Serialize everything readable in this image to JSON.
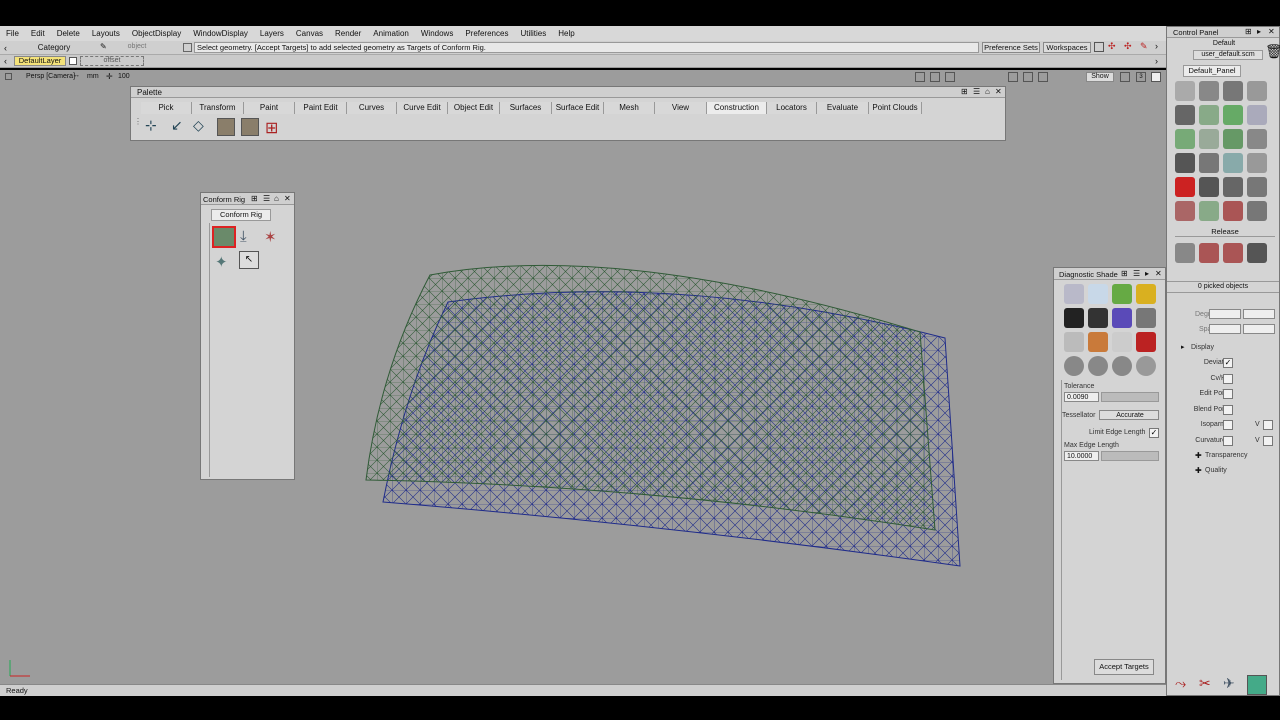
{
  "menu": [
    "File",
    "Edit",
    "Delete",
    "Layouts",
    "ObjectDisplay",
    "WindowDisplay",
    "Layers",
    "Canvas",
    "Render",
    "Animation",
    "Windows",
    "Preferences",
    "Utilities",
    "Help"
  ],
  "toolbar": {
    "category_label": "Category",
    "object_label": "object",
    "prompt": "Select geometry. [Accept Targets] to add selected geometry as Targets of Conform Rig.",
    "preference_sets": "Preference Sets",
    "workspaces": "Workspaces",
    "layer": "DefaultLayer",
    "offset": "offset"
  },
  "viewport": {
    "camera": "Persp [Camera]",
    "units": "mm",
    "zoom": "100",
    "show_btn": "Show"
  },
  "palette": {
    "title": "Palette",
    "tabs": [
      "Pick",
      "Transform",
      "Paint",
      "Paint Edit",
      "Curves",
      "Curve Edit",
      "Object Edit",
      "Surfaces",
      "Surface Edit",
      "Mesh",
      "View",
      "Construction",
      "Locators",
      "Evaluate",
      "Point Clouds"
    ],
    "active_tab": "Construction"
  },
  "conform_rig": {
    "title": "Conform Rig",
    "tab": "Conform Rig"
  },
  "diagnostic": {
    "title": "Diagnostic Shade",
    "tolerance_label": "Tolerance",
    "tolerance_value": "0.0090",
    "tessellator_label": "Tessellator",
    "tessellator_value": "Accurate",
    "limit_edge_label": "Limit Edge Length",
    "max_edge_label": "Max Edge Length",
    "max_edge_value": "10.0000",
    "accept_button": "Accept Targets"
  },
  "control_panel": {
    "title": "Control Panel",
    "preset": "Default",
    "user_file": "user_default.scm",
    "default_panel_tab": "Default_Panel",
    "release_label": "Release",
    "picked_objects": "0 picked objects",
    "degree_label": "Degree",
    "spans_label": "Spans",
    "display_label": "Display",
    "options": [
      {
        "label": "Deviation",
        "checked": true
      },
      {
        "label": "Cv/Hull",
        "checked": false
      },
      {
        "label": "Edit Points",
        "checked": false
      },
      {
        "label": "Blend Points",
        "checked": false
      },
      {
        "label": "Isoparm U",
        "checked": false,
        "v": "V"
      },
      {
        "label": "Curvature U",
        "checked": false,
        "v": "V"
      }
    ],
    "transparency_label": "Transparency",
    "quality_label": "Quality"
  },
  "status": "Ready",
  "colors": {
    "viewport_bg": "#9c9c9c",
    "mesh_green": "#2f5a36",
    "mesh_blue": "#1f2b8a",
    "panel_bg": "#d4d4d4",
    "active_tab": "#ececec"
  }
}
